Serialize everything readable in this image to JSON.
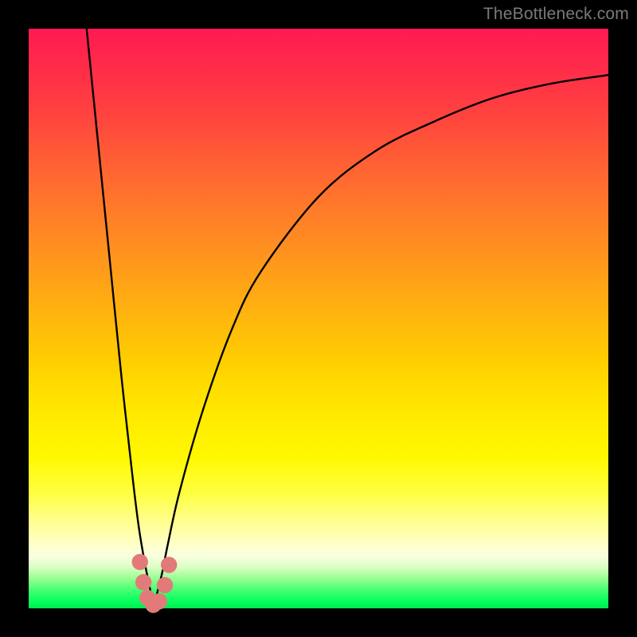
{
  "watermark": "TheBottleneck.com",
  "colors": {
    "frame": "#000000",
    "curve": "#000000",
    "marker_fill": "#e27a7a",
    "marker_stroke": "#c96666"
  },
  "chart_data": {
    "type": "line",
    "title": "",
    "xlabel": "",
    "ylabel": "",
    "xlim": [
      0,
      100
    ],
    "ylim": [
      0,
      100
    ],
    "grid": false,
    "legend": false,
    "series": [
      {
        "name": "bottleneck-curve",
        "x_optimum": 21.5,
        "x": [
          10,
          12,
          14,
          16,
          18,
          19,
          20,
          21,
          21.5,
          22,
          23,
          24,
          26,
          30,
          35,
          40,
          50,
          60,
          70,
          80,
          90,
          100
        ],
        "y": [
          100,
          80,
          60,
          40,
          22,
          14,
          8,
          3,
          0,
          2,
          6,
          11,
          20,
          34,
          48,
          58,
          71,
          79,
          84,
          88,
          90.5,
          92
        ]
      }
    ],
    "markers": [
      {
        "x": 19.2,
        "y": 8.0,
        "r": 1.4
      },
      {
        "x": 19.8,
        "y": 4.5,
        "r": 1.4
      },
      {
        "x": 20.5,
        "y": 1.8,
        "r": 1.4
      },
      {
        "x": 21.5,
        "y": 0.6,
        "r": 1.4
      },
      {
        "x": 22.5,
        "y": 1.2,
        "r": 1.4
      },
      {
        "x": 23.5,
        "y": 4.0,
        "r": 1.4
      },
      {
        "x": 24.2,
        "y": 7.5,
        "r": 1.4
      }
    ]
  }
}
